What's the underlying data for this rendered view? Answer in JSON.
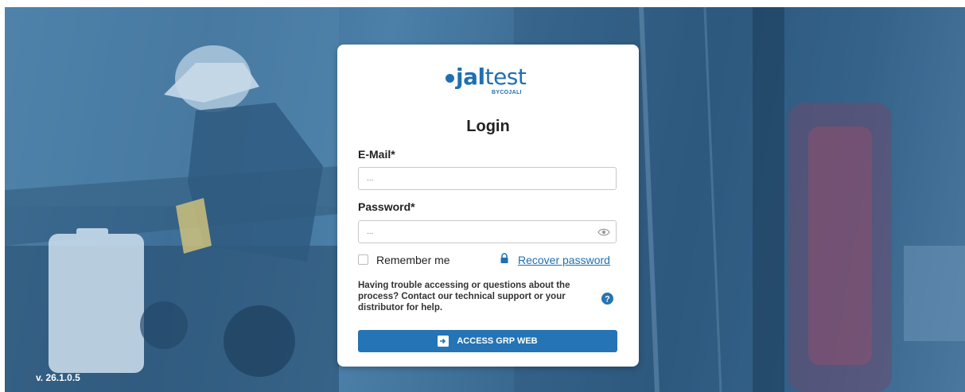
{
  "version": "v. 26.1.0.5",
  "logo": {
    "main_bold": "jal",
    "main_light": "test",
    "sub": "BYCOJALI"
  },
  "login": {
    "title": "Login",
    "email_label": "E-Mail*",
    "email_placeholder": "...",
    "password_label": "Password*",
    "password_placeholder": "...",
    "remember_label": "Remember me",
    "recover_label": "Recover password",
    "help_text": "Having trouble accessing or questions about the process? Contact our technical support or your distributor for help.",
    "access_button": "ACCESS GRP WEB"
  },
  "colors": {
    "accent": "#2574b5",
    "brand": "#1f6fb2",
    "background_tint": "#3e6f98"
  },
  "icons": [
    "eye-icon",
    "lock-icon",
    "help-icon",
    "enter-icon"
  ]
}
